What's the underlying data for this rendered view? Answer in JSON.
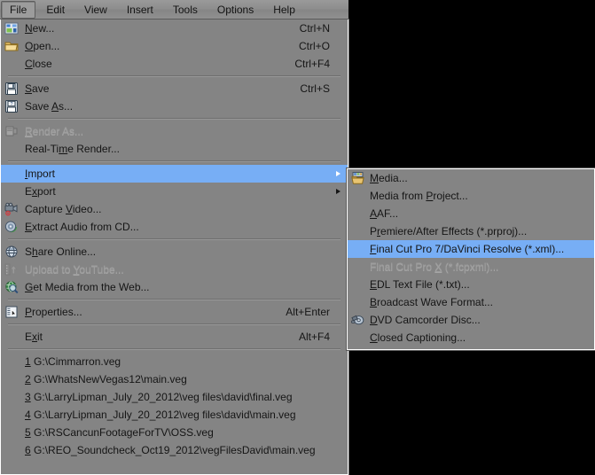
{
  "menubar": {
    "items": [
      {
        "label": "File",
        "active": true
      },
      {
        "label": "Edit",
        "active": false
      },
      {
        "label": "View",
        "active": false
      },
      {
        "label": "Insert",
        "active": false
      },
      {
        "label": "Tools",
        "active": false
      },
      {
        "label": "Options",
        "active": false
      },
      {
        "label": "Help",
        "active": false
      }
    ]
  },
  "file_menu": {
    "items": [
      {
        "label": "New...",
        "accel": "Ctrl+N",
        "icon": "new-project-icon",
        "mnemonic": "N",
        "disabled": false,
        "selected": false,
        "submenu": false
      },
      {
        "label": "Open...",
        "accel": "Ctrl+O",
        "icon": "open-folder-icon",
        "mnemonic": "O",
        "disabled": false,
        "selected": false,
        "submenu": false
      },
      {
        "label": "Close",
        "accel": "Ctrl+F4",
        "icon": "",
        "mnemonic": "C",
        "disabled": false,
        "selected": false,
        "submenu": false
      },
      {
        "separator": true
      },
      {
        "label": "Save",
        "accel": "Ctrl+S",
        "icon": "save-disk-icon",
        "mnemonic": "S",
        "disabled": false,
        "selected": false,
        "submenu": false
      },
      {
        "label": "Save As...",
        "accel": "",
        "icon": "save-as-disk-icon",
        "mnemonic": "A",
        "disabled": false,
        "selected": false,
        "submenu": false
      },
      {
        "separator": true
      },
      {
        "label": "Render As...",
        "accel": "",
        "icon": "render-icon",
        "mnemonic": "R",
        "disabled": true,
        "selected": false,
        "submenu": false
      },
      {
        "label": "Real-Time Render...",
        "accel": "",
        "icon": "",
        "mnemonic": "m",
        "disabled": false,
        "selected": false,
        "submenu": false
      },
      {
        "separator": true
      },
      {
        "label": "Import",
        "accel": "",
        "icon": "",
        "mnemonic": "I",
        "disabled": false,
        "selected": true,
        "submenu": true
      },
      {
        "label": "Export",
        "accel": "",
        "icon": "",
        "mnemonic": "x",
        "disabled": false,
        "selected": false,
        "submenu": true
      },
      {
        "label": "Capture Video...",
        "accel": "",
        "icon": "camcorder-icon",
        "mnemonic": "V",
        "disabled": false,
        "selected": false,
        "submenu": false
      },
      {
        "label": "Extract Audio from CD...",
        "accel": "",
        "icon": "cd-audio-icon",
        "mnemonic": "E",
        "disabled": false,
        "selected": false,
        "submenu": false
      },
      {
        "separator": true
      },
      {
        "label": "Share Online...",
        "accel": "",
        "icon": "share-globe-icon",
        "mnemonic": "h",
        "disabled": false,
        "selected": false,
        "submenu": false
      },
      {
        "label": "Upload to YouTube...",
        "accel": "",
        "icon": "upload-film-icon",
        "mnemonic": "Y",
        "disabled": true,
        "selected": false,
        "submenu": false
      },
      {
        "label": "Get Media from the Web...",
        "accel": "",
        "icon": "web-search-icon",
        "mnemonic": "G",
        "disabled": false,
        "selected": false,
        "submenu": false
      },
      {
        "separator": true
      },
      {
        "label": "Properties...",
        "accel": "Alt+Enter",
        "icon": "properties-icon",
        "mnemonic": "P",
        "disabled": false,
        "selected": false,
        "submenu": false
      },
      {
        "separator": true
      },
      {
        "label": "Exit",
        "accel": "Alt+F4",
        "icon": "",
        "mnemonic": "x",
        "disabled": false,
        "selected": false,
        "submenu": false
      },
      {
        "separator": true
      }
    ],
    "recent_files": [
      {
        "number": "1",
        "path": "G:\\Cimmarron.veg"
      },
      {
        "number": "2",
        "path": "G:\\WhatsNewVegas12\\main.veg"
      },
      {
        "number": "3",
        "path": "G:\\LarryLipman_July_20_2012\\veg files\\david\\final.veg"
      },
      {
        "number": "4",
        "path": "G:\\LarryLipman_July_20_2012\\veg files\\david\\main.veg"
      },
      {
        "number": "5",
        "path": "G:\\RSCancunFootageForTV\\OSS.veg"
      },
      {
        "number": "6",
        "path": "G:\\REO_Soundcheck_Oct19_2012\\vegFilesDavid\\main.veg"
      }
    ]
  },
  "import_menu": {
    "items": [
      {
        "label": "Media...",
        "icon": "import-media-icon",
        "mnemonic": "M",
        "disabled": false,
        "selected": false
      },
      {
        "label": "Media from Project...",
        "icon": "",
        "mnemonic": "P",
        "disabled": false,
        "selected": false
      },
      {
        "label": "AAF...",
        "icon": "",
        "mnemonic": "A",
        "disabled": false,
        "selected": false
      },
      {
        "label": "Premiere/After Effects (*.prproj)...",
        "icon": "",
        "mnemonic": "r",
        "disabled": false,
        "selected": false
      },
      {
        "label": "Final Cut Pro 7/DaVinci Resolve (*.xml)...",
        "icon": "",
        "mnemonic": "F",
        "disabled": false,
        "selected": true
      },
      {
        "label": "Final Cut Pro X (*.fcpxml)...",
        "icon": "",
        "mnemonic": "X",
        "disabled": true,
        "selected": false
      },
      {
        "label": "EDL Text File (*.txt)...",
        "icon": "",
        "mnemonic": "E",
        "disabled": false,
        "selected": false
      },
      {
        "label": "Broadcast Wave Format...",
        "icon": "",
        "mnemonic": "B",
        "disabled": false,
        "selected": false
      },
      {
        "label": "DVD Camcorder Disc...",
        "icon": "dvd-camcorder-icon",
        "mnemonic": "D",
        "disabled": false,
        "selected": false
      },
      {
        "label": "Closed Captioning...",
        "icon": "",
        "mnemonic": "C",
        "disabled": false,
        "selected": false
      }
    ]
  },
  "colors": {
    "menu_background": "#848484",
    "highlight": "#77aef5",
    "text": "#151515",
    "disabled_text": "#9d9d9d",
    "separator": "#6f6f6f",
    "page_background": "#000000"
  }
}
